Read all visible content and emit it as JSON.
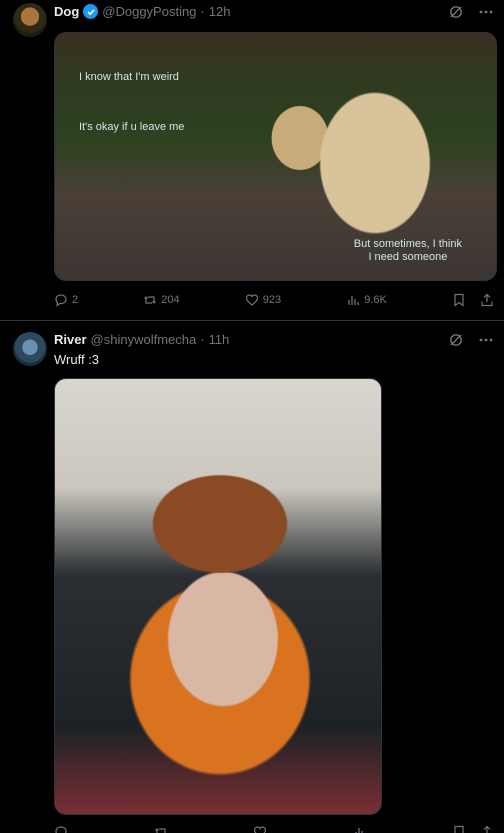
{
  "tweets": [
    {
      "name": "Dog",
      "handle": "@DoggyPosting",
      "separator": "·",
      "time": "12h",
      "verified": true,
      "media_captions": [
        "I know that I'm weird",
        "It's okay if u leave me",
        "But sometimes, I think",
        "I need someone"
      ],
      "stats": {
        "replies": "2",
        "reposts": "204",
        "likes": "923",
        "views": "9.6K"
      }
    },
    {
      "name": "River",
      "handle": "@shinywolfmecha",
      "separator": "·",
      "time": "11h",
      "text": "Wruff :3"
    }
  ],
  "colors": {
    "background": "#000000",
    "text_primary": "#e7e9ea",
    "text_secondary": "#71767b",
    "verified": "#1d9bf0",
    "divider": "#2f3336"
  },
  "icons": [
    "grok-icon",
    "more-icon",
    "reply-icon",
    "repost-icon",
    "like-icon",
    "views-icon",
    "bookmark-icon",
    "share-icon",
    "verified-badge-icon"
  ]
}
